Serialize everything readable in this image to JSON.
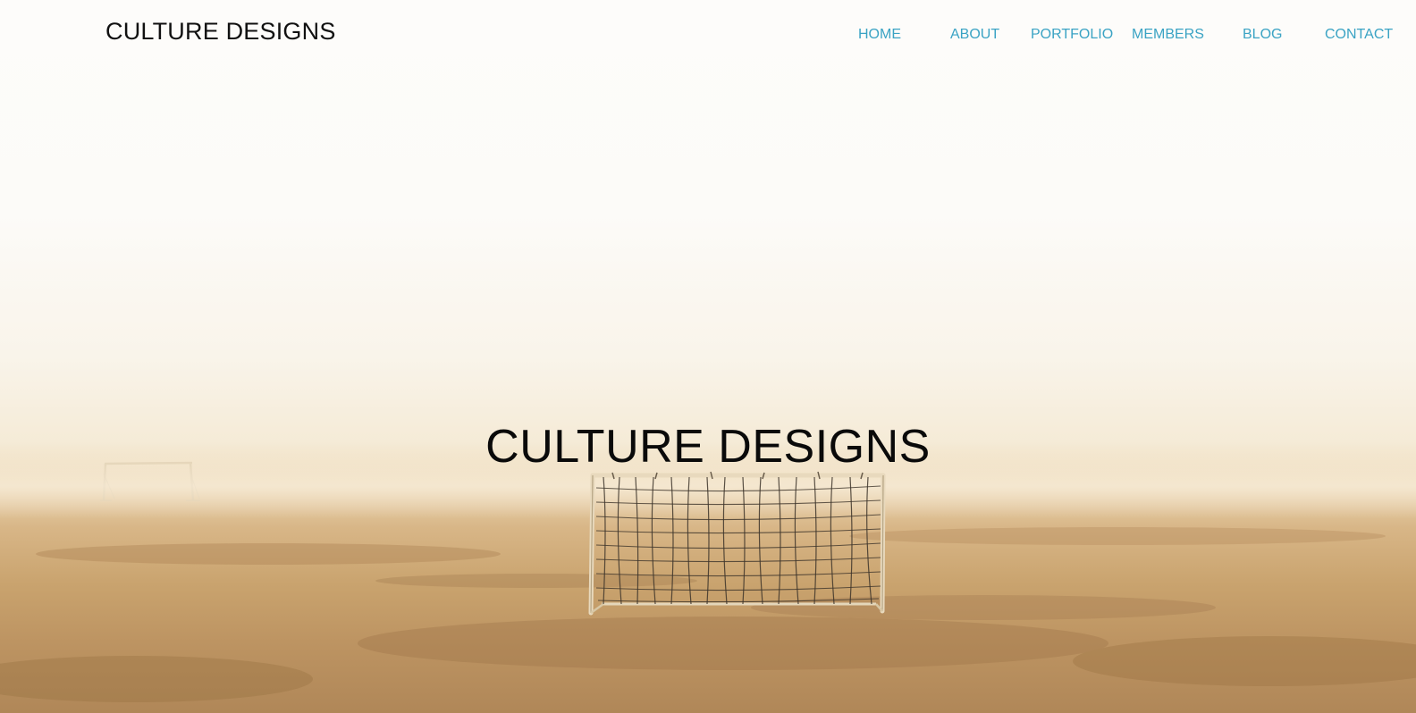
{
  "header": {
    "logo_text": "CULTURE DESIGNS"
  },
  "nav": {
    "items": [
      {
        "label": "HOME"
      },
      {
        "label": "ABOUT"
      },
      {
        "label": "PORTFOLIO"
      },
      {
        "label": "MEMBERS"
      },
      {
        "label": "BLOG"
      },
      {
        "label": "CONTACT"
      }
    ]
  },
  "hero": {
    "title": "CULTURE DESIGNS",
    "background": "foggy-soccer-field-with-goal"
  },
  "colors": {
    "nav_link": "#3aa3c4",
    "text": "#111111"
  }
}
